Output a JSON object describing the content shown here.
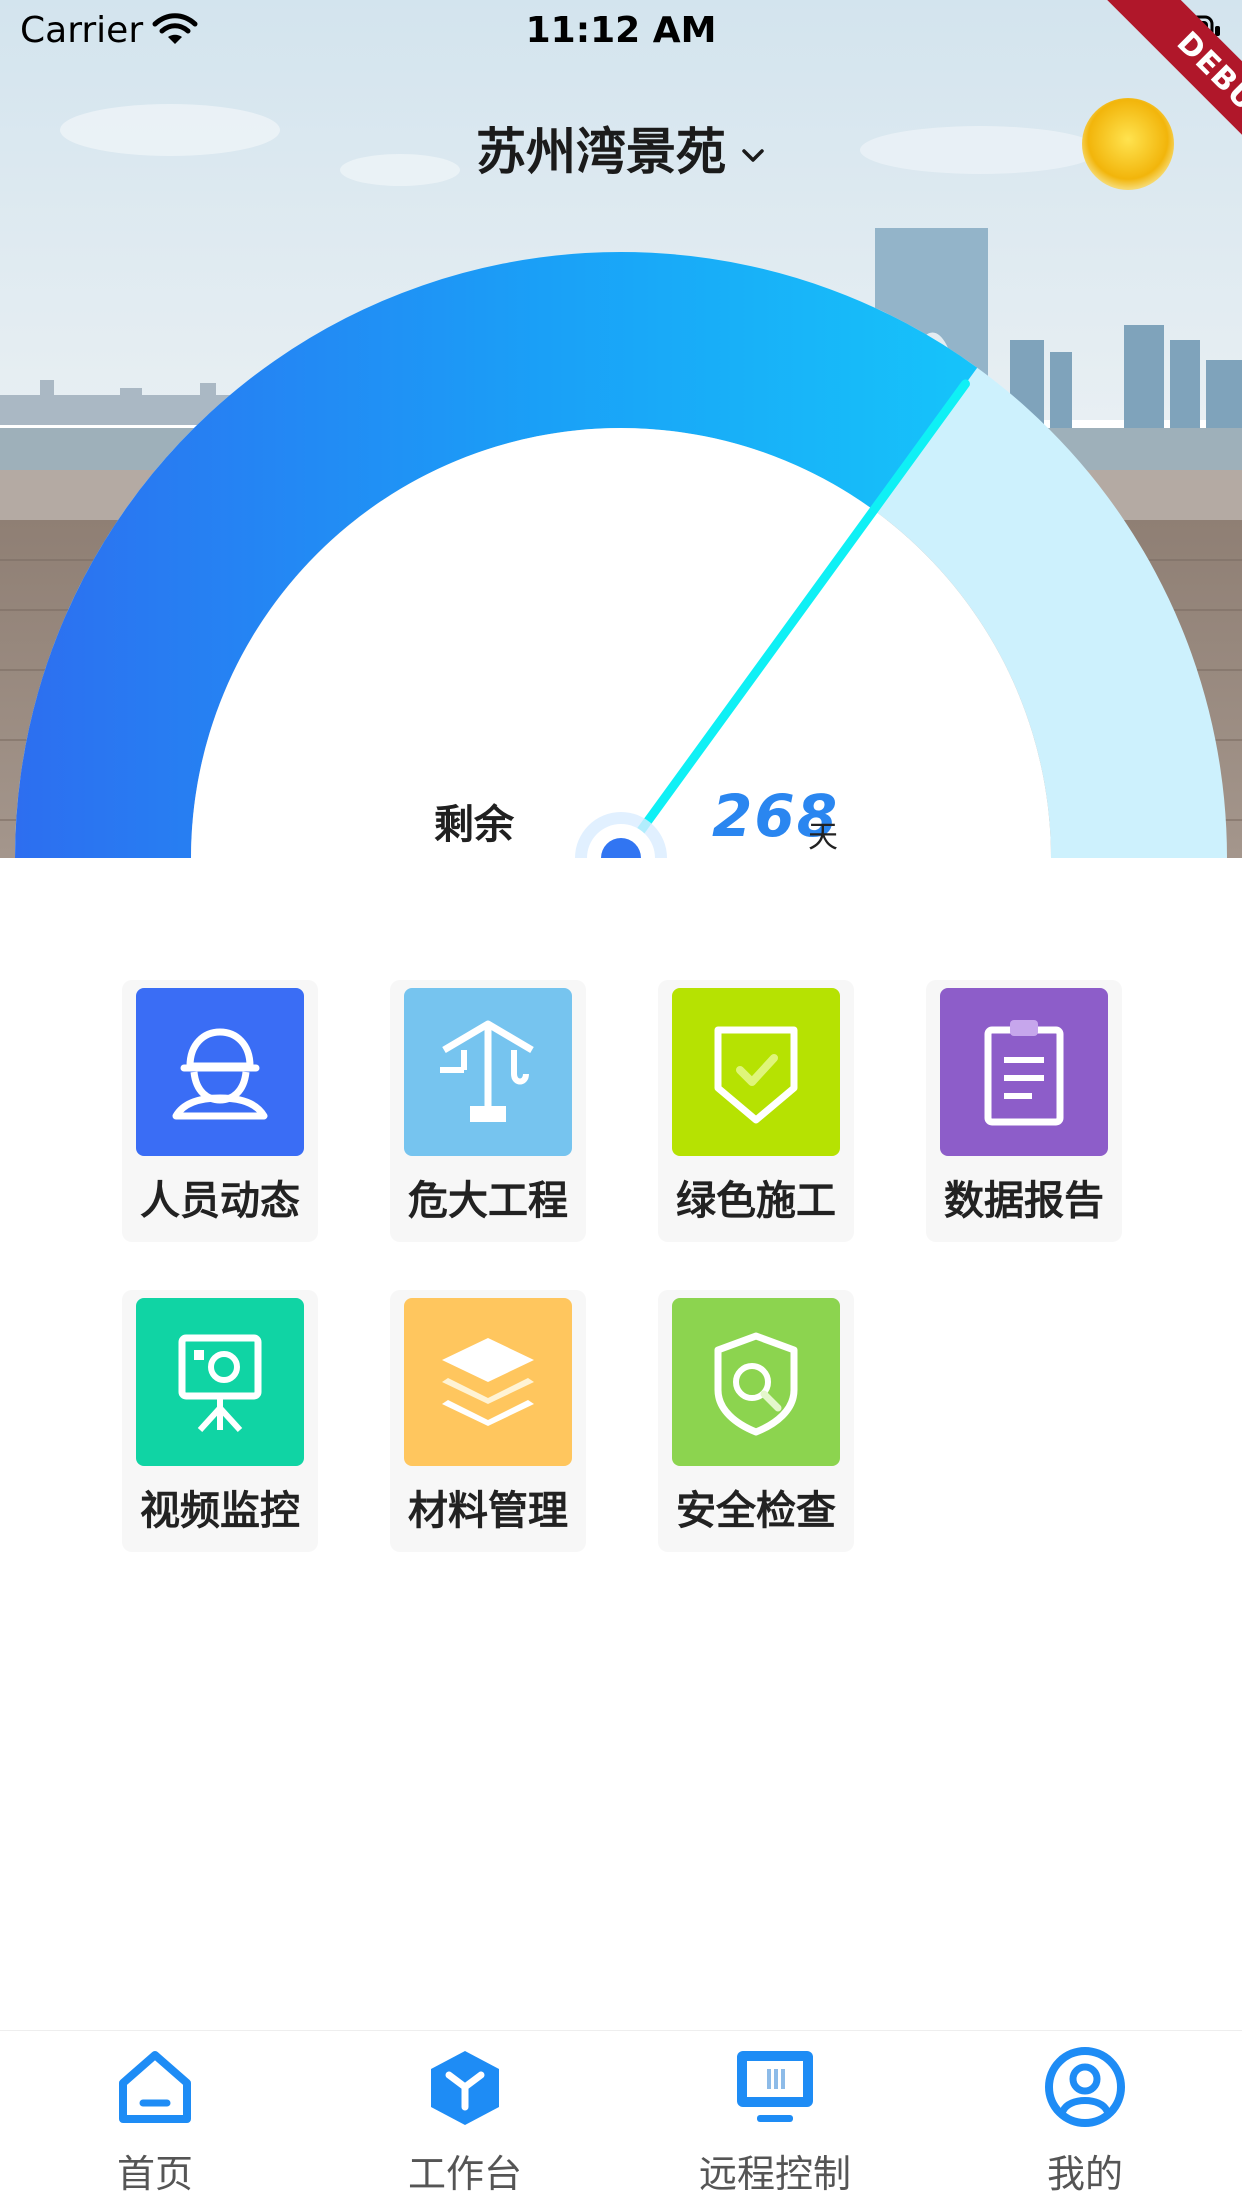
{
  "status_bar": {
    "carrier": "Carrier",
    "time": "11:12 AM",
    "debug_label": "DEBUG"
  },
  "header": {
    "project_name": "苏州湾景苑"
  },
  "gauge": {
    "remaining_label": "剩余",
    "remaining_days": "268",
    "unit": "天",
    "progress_fraction": 0.7
  },
  "modules": [
    {
      "label": "人员动态",
      "icon": "worker-helmet-icon",
      "color": "#3a6df5"
    },
    {
      "label": "危大工程",
      "icon": "tower-crane-icon",
      "color": "#76c4ef"
    },
    {
      "label": "绿色施工",
      "icon": "shield-check-icon",
      "color": "#b6e202"
    },
    {
      "label": "数据报告",
      "icon": "clipboard-report-icon",
      "color": "#8d5dc9"
    },
    {
      "label": "视频监控",
      "icon": "camera-tripod-icon",
      "color": "#10d4a4"
    },
    {
      "label": "材料管理",
      "icon": "layers-icon",
      "color": "#ffc65e"
    },
    {
      "label": "安全检查",
      "icon": "shield-search-icon",
      "color": "#8cd44f"
    }
  ],
  "tabbar": {
    "items": [
      {
        "label": "首页",
        "icon": "home-icon"
      },
      {
        "label": "工作台",
        "icon": "workbench-cube-icon"
      },
      {
        "label": "远程控制",
        "icon": "monitor-icon"
      },
      {
        "label": "我的",
        "icon": "profile-icon"
      }
    ],
    "accent": "#1e8cf5"
  }
}
